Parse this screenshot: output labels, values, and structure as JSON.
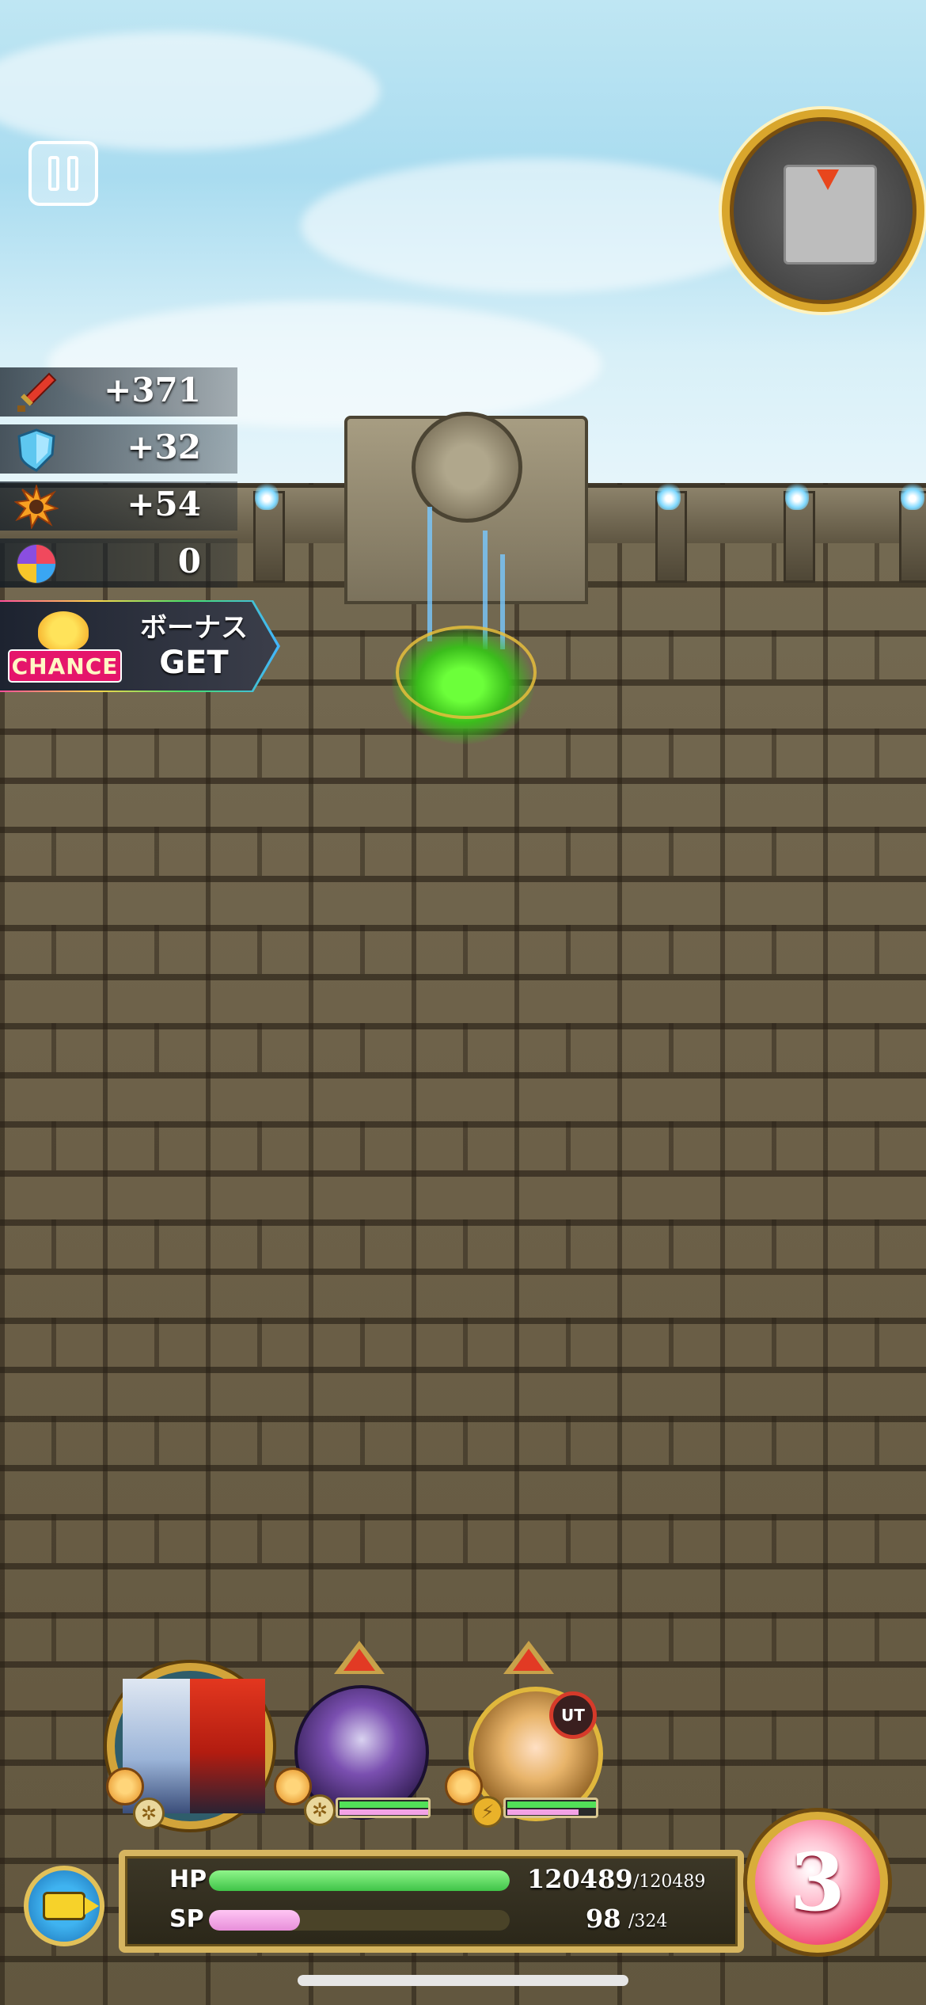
{
  "hud": {
    "pause_icon": "pause-icon",
    "minimap_icon": "minimap"
  },
  "stats": [
    {
      "icon": "sword-icon",
      "value": "+371"
    },
    {
      "icon": "shield-icon",
      "value": "+32"
    },
    {
      "icon": "burst-icon",
      "value": "+54"
    },
    {
      "icon": "orb-icon",
      "value": "0"
    }
  ],
  "bonus": {
    "chance_label": "CHANCE",
    "line1": "ボーナス",
    "line2": "GET"
  },
  "party": {
    "member2_badge": "UT"
  },
  "status": {
    "hp_label": "HP",
    "hp_current": "120489",
    "hp_max": "/120489",
    "hp_fraction": 1.0,
    "sp_label": "SP",
    "sp_current": "98",
    "sp_max": "/324",
    "sp_fraction": 0.302
  },
  "counter": "3",
  "colors": {
    "hp_fill": "#52e058",
    "sp_fill": "#f3a2e6",
    "gold_frame": "#d6b560"
  }
}
